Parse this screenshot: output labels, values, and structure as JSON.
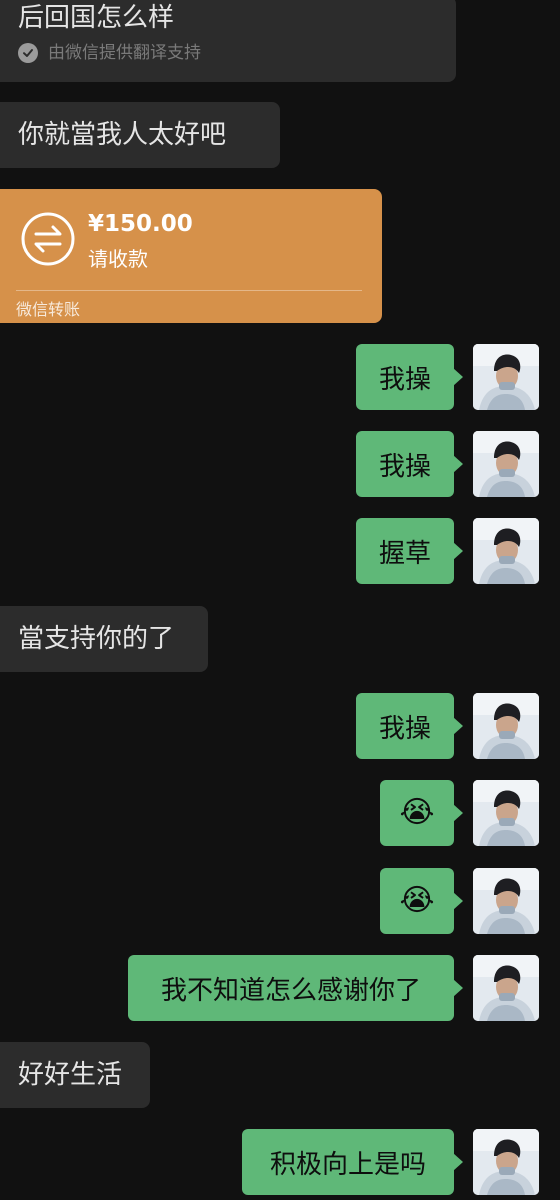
{
  "messages": {
    "m1": {
      "text": "后回国怎么样",
      "translate_note": "由微信提供翻译支持"
    },
    "m2": {
      "text": "你就當我人太好吧"
    },
    "transfer": {
      "amount": "¥150.00",
      "status": "请收款",
      "footer": "微信转账"
    },
    "m4": {
      "text": "我操"
    },
    "m5": {
      "text": "我操"
    },
    "m6": {
      "text": "握草"
    },
    "m7": {
      "text": "當支持你的了"
    },
    "m8": {
      "text": "我操"
    },
    "m9": {
      "text": "😭"
    },
    "m10": {
      "text": "😭"
    },
    "m11": {
      "text": "我不知道怎么感谢你了"
    },
    "m12": {
      "text": "好好生活"
    },
    "m13": {
      "text": "积极向上是吗"
    }
  },
  "colors": {
    "background": "#111111",
    "incoming_bubble": "#2c2c2c",
    "outgoing_bubble": "#5fb878",
    "transfer_card": "#d6914a"
  },
  "icons": {
    "transfer": "transfer-arrows-icon",
    "check": "check-circle-icon"
  }
}
